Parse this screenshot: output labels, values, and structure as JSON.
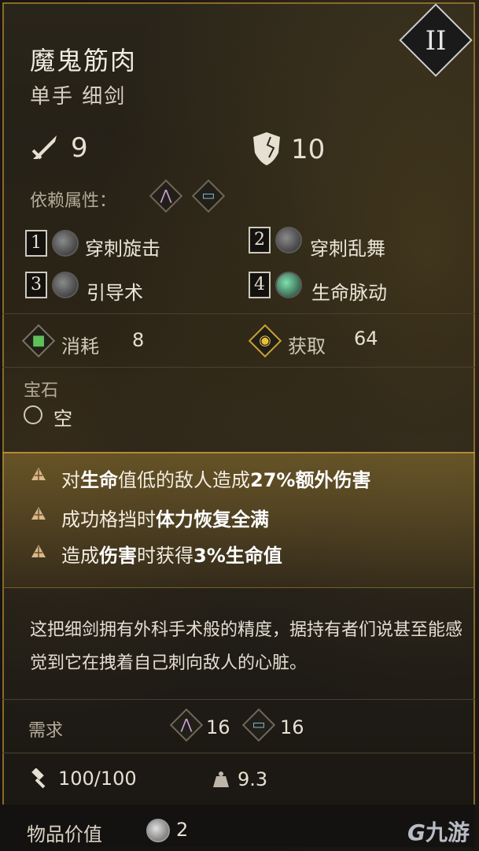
{
  "item": {
    "name": "魔鬼筋肉",
    "type": "单手 细剑",
    "tier": "II"
  },
  "stats": {
    "damage": "9",
    "defense": "10"
  },
  "scaling": {
    "label": "依赖属性："
  },
  "skills": [
    {
      "num": "1",
      "name": "穿刺旋击"
    },
    {
      "num": "2",
      "name": "穿刺乱舞"
    },
    {
      "num": "3",
      "name": "引导术"
    },
    {
      "num": "4",
      "name": "生命脉动"
    }
  ],
  "costs": {
    "consume_label": "消耗",
    "consume_value": "8",
    "gain_label": "获取",
    "gain_value": "64"
  },
  "gem": {
    "label": "宝石",
    "slot": "空"
  },
  "bonuses": [
    {
      "pre": "对",
      "b1": "生命",
      "mid": "值低的敌人造成",
      "b2": "27%额外伤害",
      "post": ""
    },
    {
      "pre": "成功格挡时",
      "b1": "体力恢复全满",
      "mid": "",
      "b2": "",
      "post": ""
    },
    {
      "pre": "造成",
      "b1": "伤害",
      "mid": "时获得",
      "b2": "3%生命值",
      "post": ""
    }
  ],
  "description": "这把细剑拥有外科手术般的精度，据持有者们说甚至能感觉到它在拽着自己刺向敌人的心脏。",
  "requirements": {
    "label": "需求",
    "faith": "16",
    "arcane": "16"
  },
  "durability": "100/100",
  "weight": "9.3",
  "value": {
    "label": "物品价值",
    "amount": "2"
  },
  "watermark": "九游"
}
